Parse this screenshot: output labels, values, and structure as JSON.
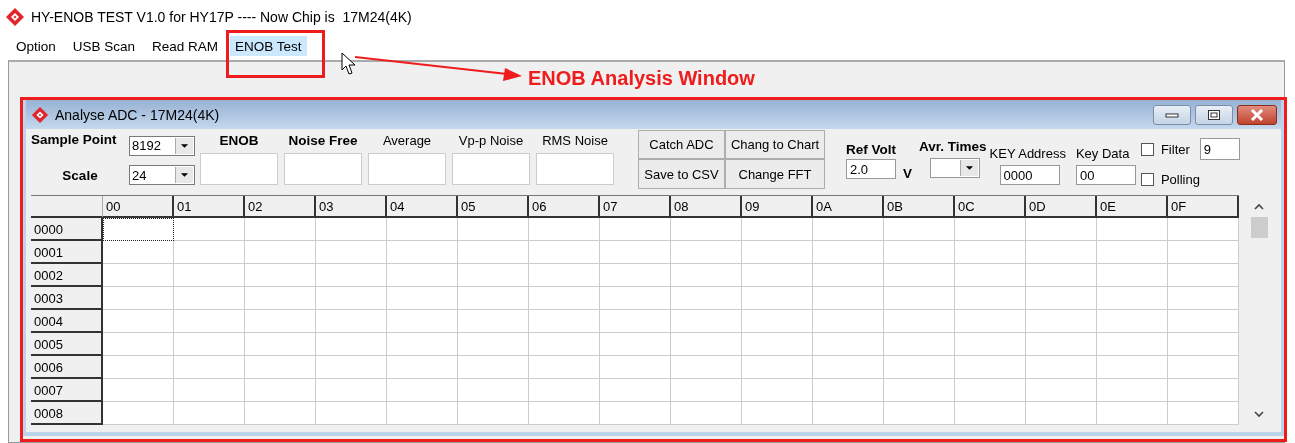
{
  "window": {
    "title": "HY-ENOB TEST V1.0 for HY17P ---- Now Chip is  17M24(4K)"
  },
  "menu": [
    {
      "label": "Option",
      "selected": false
    },
    {
      "label": "USB Scan",
      "selected": false
    },
    {
      "label": "Read RAM",
      "selected": false
    },
    {
      "label": "ENOB Test",
      "selected": true
    }
  ],
  "callout": {
    "label": "ENOB Analysis Window"
  },
  "child_window": {
    "title": "Analyse ADC - 17M24(4K)",
    "sample_point": {
      "label": "Sample Point",
      "value": "8192"
    },
    "scale": {
      "label": "Scale",
      "value": "24"
    },
    "results": [
      {
        "label": "ENOB",
        "bold": true
      },
      {
        "label": "Noise Free",
        "bold": true
      },
      {
        "label": "Average",
        "bold": false
      },
      {
        "label": "Vp-p Noise",
        "bold": false
      },
      {
        "label": "RMS Noise",
        "bold": false
      }
    ],
    "buttons": [
      "Catch ADC",
      "Chang to Chart",
      "Save to CSV",
      "Change FFT"
    ],
    "ref_volt": {
      "label": "Ref Volt",
      "value": "2.0",
      "unit": "V"
    },
    "avr_times": {
      "label": "Avr. Times"
    },
    "key_address": {
      "label": "KEY Address",
      "value": "0000"
    },
    "key_data": {
      "label": "Key Data",
      "value": "00"
    },
    "filter": {
      "label": "Filter",
      "checked": false,
      "value": "9"
    },
    "polling": {
      "label": "Polling",
      "checked": false
    },
    "grid": {
      "columns": [
        "00",
        "01",
        "02",
        "03",
        "04",
        "05",
        "06",
        "07",
        "08",
        "09",
        "0A",
        "0B",
        "0C",
        "0D",
        "0E",
        "0F"
      ],
      "rows": [
        {
          "label": "0000",
          "cells": [
            {
              "focused": true
            },
            {
              "focused": false
            },
            {
              "focused": false
            },
            {
              "focused": false
            },
            {
              "focused": false
            },
            {
              "focused": false
            },
            {
              "focused": false
            },
            {
              "focused": false
            },
            {
              "focused": false
            },
            {
              "focused": false
            },
            {
              "focused": false
            },
            {
              "focused": false
            },
            {
              "focused": false
            },
            {
              "focused": false
            },
            {
              "focused": false
            },
            {
              "focused": false
            }
          ]
        },
        {
          "label": "0001",
          "cells": [
            {
              "focused": false
            },
            {
              "focused": false
            },
            {
              "focused": false
            },
            {
              "focused": false
            },
            {
              "focused": false
            },
            {
              "focused": false
            },
            {
              "focused": false
            },
            {
              "focused": false
            },
            {
              "focused": false
            },
            {
              "focused": false
            },
            {
              "focused": false
            },
            {
              "focused": false
            },
            {
              "focused": false
            },
            {
              "focused": false
            },
            {
              "focused": false
            },
            {
              "focused": false
            }
          ]
        },
        {
          "label": "0002",
          "cells": [
            {
              "focused": false
            },
            {
              "focused": false
            },
            {
              "focused": false
            },
            {
              "focused": false
            },
            {
              "focused": false
            },
            {
              "focused": false
            },
            {
              "focused": false
            },
            {
              "focused": false
            },
            {
              "focused": false
            },
            {
              "focused": false
            },
            {
              "focused": false
            },
            {
              "focused": false
            },
            {
              "focused": false
            },
            {
              "focused": false
            },
            {
              "focused": false
            },
            {
              "focused": false
            }
          ]
        },
        {
          "label": "0003",
          "cells": [
            {
              "focused": false
            },
            {
              "focused": false
            },
            {
              "focused": false
            },
            {
              "focused": false
            },
            {
              "focused": false
            },
            {
              "focused": false
            },
            {
              "focused": false
            },
            {
              "focused": false
            },
            {
              "focused": false
            },
            {
              "focused": false
            },
            {
              "focused": false
            },
            {
              "focused": false
            },
            {
              "focused": false
            },
            {
              "focused": false
            },
            {
              "focused": false
            },
            {
              "focused": false
            }
          ]
        },
        {
          "label": "0004",
          "cells": [
            {
              "focused": false
            },
            {
              "focused": false
            },
            {
              "focused": false
            },
            {
              "focused": false
            },
            {
              "focused": false
            },
            {
              "focused": false
            },
            {
              "focused": false
            },
            {
              "focused": false
            },
            {
              "focused": false
            },
            {
              "focused": false
            },
            {
              "focused": false
            },
            {
              "focused": false
            },
            {
              "focused": false
            },
            {
              "focused": false
            },
            {
              "focused": false
            },
            {
              "focused": false
            }
          ]
        },
        {
          "label": "0005",
          "cells": [
            {
              "focused": false
            },
            {
              "focused": false
            },
            {
              "focused": false
            },
            {
              "focused": false
            },
            {
              "focused": false
            },
            {
              "focused": false
            },
            {
              "focused": false
            },
            {
              "focused": false
            },
            {
              "focused": false
            },
            {
              "focused": false
            },
            {
              "focused": false
            },
            {
              "focused": false
            },
            {
              "focused": false
            },
            {
              "focused": false
            },
            {
              "focused": false
            },
            {
              "focused": false
            }
          ]
        },
        {
          "label": "0006",
          "cells": [
            {
              "focused": false
            },
            {
              "focused": false
            },
            {
              "focused": false
            },
            {
              "focused": false
            },
            {
              "focused": false
            },
            {
              "focused": false
            },
            {
              "focused": false
            },
            {
              "focused": false
            },
            {
              "focused": false
            },
            {
              "focused": false
            },
            {
              "focused": false
            },
            {
              "focused": false
            },
            {
              "focused": false
            },
            {
              "focused": false
            },
            {
              "focused": false
            },
            {
              "focused": false
            }
          ]
        },
        {
          "label": "0007",
          "cells": [
            {
              "focused": false
            },
            {
              "focused": false
            },
            {
              "focused": false
            },
            {
              "focused": false
            },
            {
              "focused": false
            },
            {
              "focused": false
            },
            {
              "focused": false
            },
            {
              "focused": false
            },
            {
              "focused": false
            },
            {
              "focused": false
            },
            {
              "focused": false
            },
            {
              "focused": false
            },
            {
              "focused": false
            },
            {
              "focused": false
            },
            {
              "focused": false
            },
            {
              "focused": false
            }
          ]
        },
        {
          "label": "0008",
          "cells": [
            {
              "focused": false
            },
            {
              "focused": false
            },
            {
              "focused": false
            },
            {
              "focused": false
            },
            {
              "focused": false
            },
            {
              "focused": false
            },
            {
              "focused": false
            },
            {
              "focused": false
            },
            {
              "focused": false
            },
            {
              "focused": false
            },
            {
              "focused": false
            },
            {
              "focused": false
            },
            {
              "focused": false
            },
            {
              "focused": false
            },
            {
              "focused": false
            },
            {
              "focused": false
            }
          ]
        }
      ]
    }
  }
}
